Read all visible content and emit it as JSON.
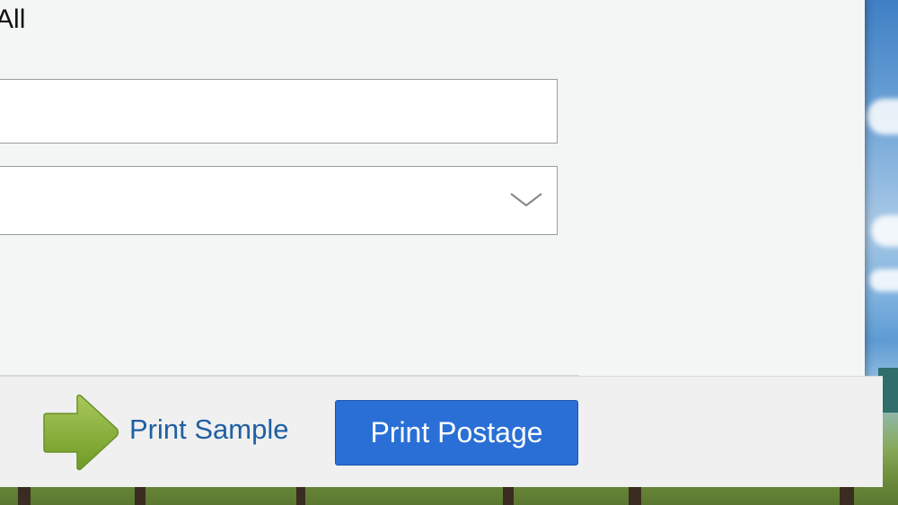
{
  "dialog": {
    "heading": "t All",
    "text_field": {
      "value": "",
      "placeholder": ""
    },
    "dropdown": {
      "selected": ""
    }
  },
  "footer": {
    "print_sample_label": "Print Sample",
    "print_postage_label": "Print Postage"
  },
  "icons": {
    "sample_arrow": "arrow-right-icon",
    "dropdown_chevron": "chevron-down-icon"
  },
  "colors": {
    "primary_button": "#2a6fd6",
    "link": "#1f5fa3",
    "arrow_green": "#8cb33a"
  }
}
